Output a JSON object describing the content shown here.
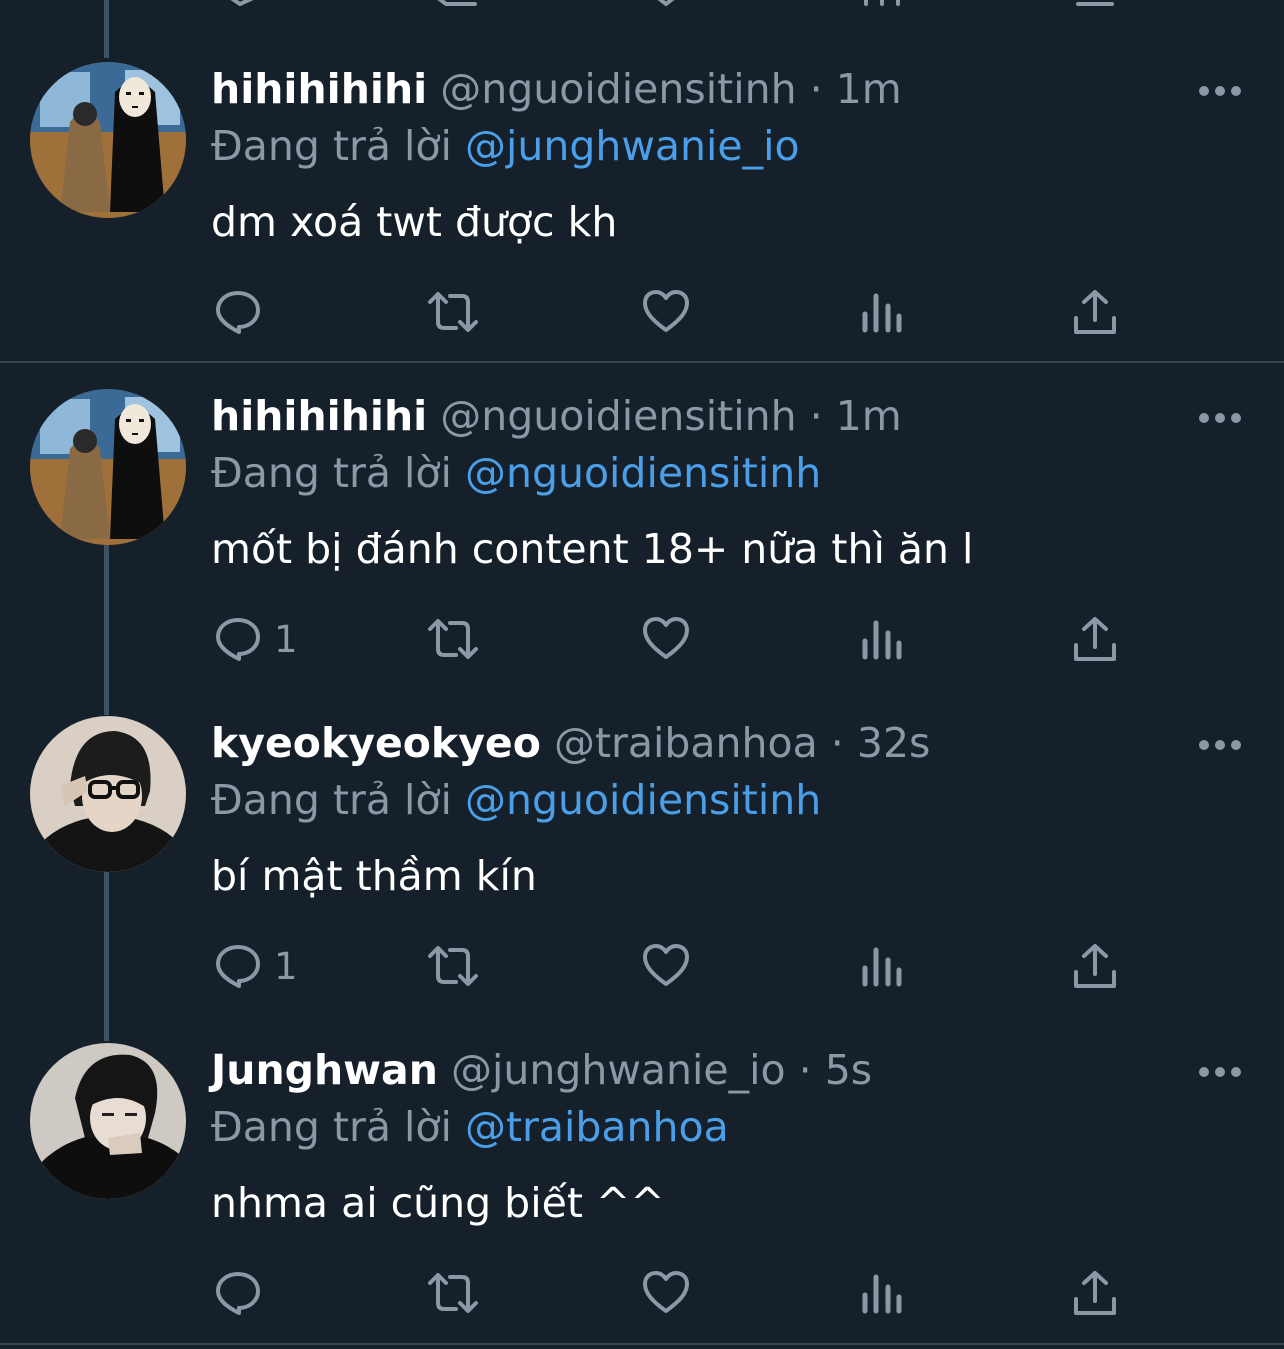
{
  "colors": {
    "background": "#15202b",
    "secondary_text": "#8b98a5",
    "mention": "#4a9fe8",
    "divider": "#38444d",
    "thread_line": "#3d5466"
  },
  "reply_prefix": "Đang trả lời",
  "tweets": [
    {
      "display_name": "hihihihihi",
      "handle": "@nguoidiensitinh",
      "separator": "·",
      "time": "1m",
      "reply_to": "@junghwanie_io",
      "text": "dm xoá twt được kh",
      "reply_count": "",
      "avatar_icon": "avatar-photo-noface"
    },
    {
      "display_name": "hihihihihi",
      "handle": "@nguoidiensitinh",
      "separator": "·",
      "time": "1m",
      "reply_to": "@nguoidiensitinh",
      "text": "mốt bị đánh content 18+ nữa thì ăn l",
      "reply_count": "1",
      "avatar_icon": "avatar-photo-noface"
    },
    {
      "display_name": "kyeokyeokyeo",
      "handle": "@traibanhoa",
      "separator": "·",
      "time": "32s",
      "reply_to": "@nguoidiensitinh",
      "text": "bí mật thầm kín",
      "reply_count": "1",
      "avatar_icon": "avatar-photo-glasses"
    },
    {
      "display_name": "Junghwan",
      "handle": "@junghwanie_io",
      "separator": "·",
      "time": "5s",
      "reply_to": "@traibanhoa",
      "text": "nhma ai cũng biết ^^",
      "reply_count": "",
      "avatar_icon": "avatar-photo-dark"
    }
  ]
}
